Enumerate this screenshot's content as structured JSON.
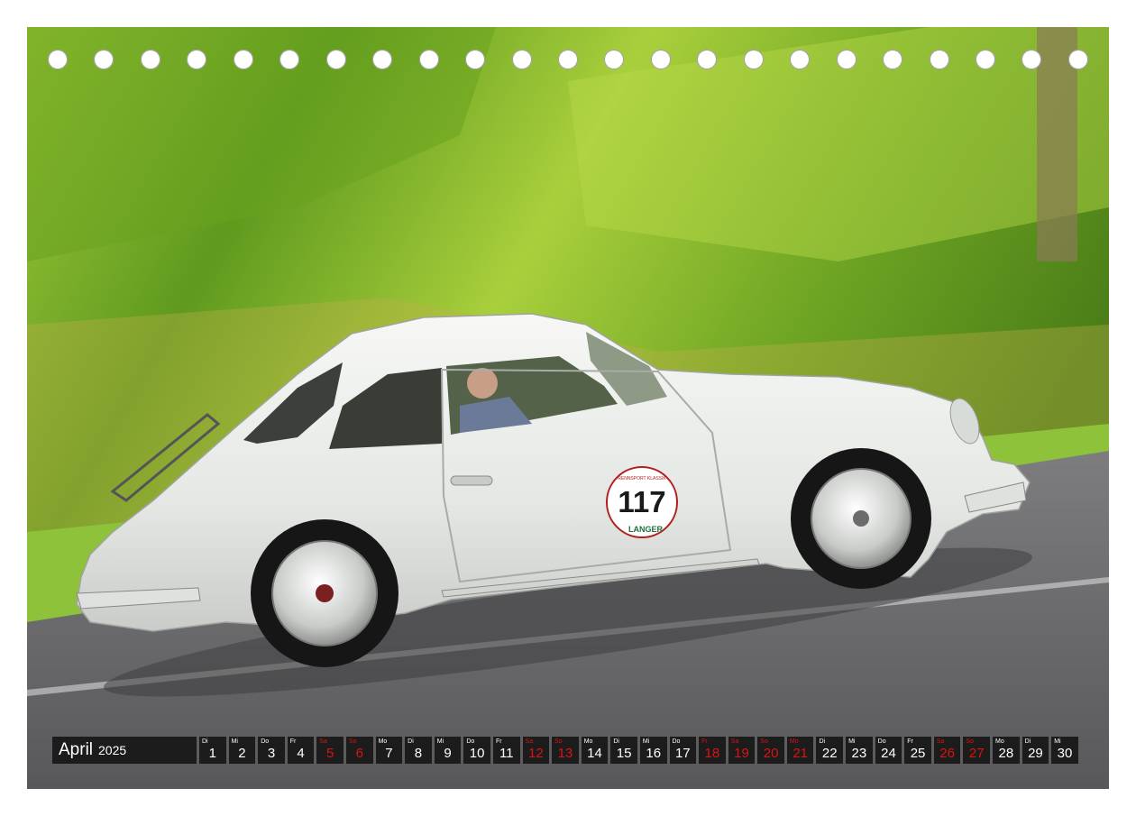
{
  "calendar": {
    "month": "April",
    "year": "2025",
    "weekend_color": "#d81414",
    "days": [
      {
        "wd": "Di",
        "n": "1",
        "we": false
      },
      {
        "wd": "Mi",
        "n": "2",
        "we": false
      },
      {
        "wd": "Do",
        "n": "3",
        "we": false
      },
      {
        "wd": "Fr",
        "n": "4",
        "we": false
      },
      {
        "wd": "Sa",
        "n": "5",
        "we": true
      },
      {
        "wd": "So",
        "n": "6",
        "we": true
      },
      {
        "wd": "Mo",
        "n": "7",
        "we": false
      },
      {
        "wd": "Di",
        "n": "8",
        "we": false
      },
      {
        "wd": "Mi",
        "n": "9",
        "we": false
      },
      {
        "wd": "Do",
        "n": "10",
        "we": false
      },
      {
        "wd": "Fr",
        "n": "11",
        "we": false
      },
      {
        "wd": "Sa",
        "n": "12",
        "we": true
      },
      {
        "wd": "So",
        "n": "13",
        "we": true
      },
      {
        "wd": "Mo",
        "n": "14",
        "we": false
      },
      {
        "wd": "Di",
        "n": "15",
        "we": false
      },
      {
        "wd": "Mi",
        "n": "16",
        "we": false
      },
      {
        "wd": "Do",
        "n": "17",
        "we": false
      },
      {
        "wd": "Fr",
        "n": "18",
        "we": true
      },
      {
        "wd": "Sa",
        "n": "19",
        "we": true
      },
      {
        "wd": "So",
        "n": "20",
        "we": true
      },
      {
        "wd": "Mo",
        "n": "21",
        "we": true
      },
      {
        "wd": "Di",
        "n": "22",
        "we": false
      },
      {
        "wd": "Mi",
        "n": "23",
        "we": false
      },
      {
        "wd": "Do",
        "n": "24",
        "we": false
      },
      {
        "wd": "Fr",
        "n": "25",
        "we": false
      },
      {
        "wd": "Sa",
        "n": "26",
        "we": true
      },
      {
        "wd": "So",
        "n": "27",
        "we": true
      },
      {
        "wd": "Mo",
        "n": "28",
        "we": false
      },
      {
        "wd": "Di",
        "n": "29",
        "we": false
      },
      {
        "wd": "Mi",
        "n": "30",
        "we": false
      }
    ]
  },
  "photo": {
    "race_number": "117",
    "plate_text": "LANGER",
    "plate_top_text": "RENNSPORT KLASSIK",
    "car_color": "#eef0ed",
    "foliage_color": "#7fb22a",
    "road_color": "#6b6b6d"
  }
}
